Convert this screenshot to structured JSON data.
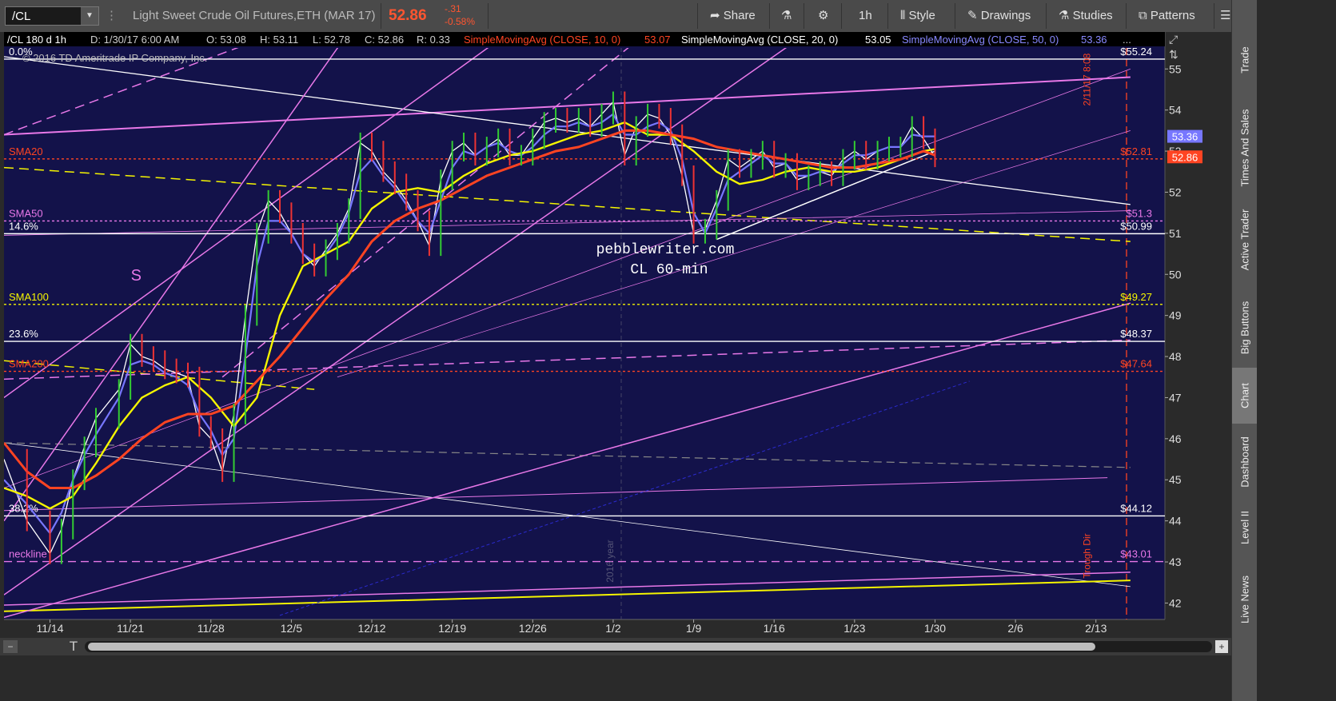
{
  "toolbar": {
    "symbol": "/CL",
    "description": "Light Sweet Crude Oil Futures,ETH (MAR 17)",
    "last": "52.86",
    "change": "-.31",
    "change_pct": "-0.58%",
    "share": "Share",
    "timeframe": "1h",
    "style": "Style",
    "drawings": "Drawings",
    "studies": "Studies",
    "patterns": "Patterns"
  },
  "header": {
    "symbol_period": "/CL 180 d 1h",
    "date": "D: 1/30/17 6:00 AM",
    "open": "O: 53.08",
    "high": "H: 53.11",
    "low": "L: 52.78",
    "close": "C: 52.86",
    "range": "R: 0.33",
    "sma10_label": "SimpleMovingAvg (CLOSE, 10, 0)",
    "sma10_val": "53.07",
    "sma20_label": "SimpleMovingAvg (CLOSE, 20, 0)",
    "sma20_val": "53.05",
    "sma50_label": "SimpleMovingAvg (CLOSE, 50, 0)",
    "sma50_val": "53.36",
    "more": "..."
  },
  "copyright": "© 2016 TD Ameritrade IP Company, Inc.",
  "watermark": {
    "line1": "pebblewriter.com",
    "line2": "CL  60-min"
  },
  "colors": {
    "bg": "#13124a",
    "magenta": "#e878e8",
    "yellow": "#f5f500",
    "red": "#ff4422",
    "blue": "#7777ff",
    "white": "#ffffff"
  },
  "chart_data": {
    "type": "line",
    "title": "",
    "ylim": [
      41.6,
      55.9
    ],
    "y_ticks": [
      42,
      43,
      44,
      45,
      46,
      47,
      48,
      49,
      50,
      51,
      52,
      53,
      54,
      55
    ],
    "x_ticks": [
      "11/14",
      "11/21",
      "11/28",
      "12/5",
      "12/12",
      "12/19",
      "12/26",
      "1/2",
      "1/9",
      "1/16",
      "1/23",
      "1/30",
      "2/6",
      "2/13"
    ],
    "x_index": [
      0,
      7,
      14,
      21,
      28,
      35,
      42,
      49,
      56,
      63,
      70,
      77,
      84,
      91
    ],
    "x_range": [
      -4,
      97
    ],
    "grid": false,
    "price_labels": [
      {
        "text": "53.36",
        "value": 53.36,
        "color": "#7777ff"
      },
      {
        "text": "52.86",
        "value": 52.86,
        "color": "#ff4422"
      }
    ],
    "series": [
      {
        "name": "Price",
        "color": "#ffffff",
        "x": [
          -4,
          -2,
          0,
          1,
          2,
          3,
          4,
          6,
          7,
          8,
          9,
          10,
          11,
          12,
          13,
          14,
          15,
          16,
          17,
          18,
          19,
          20,
          21,
          22,
          23,
          24,
          25,
          26,
          27,
          28,
          29,
          30,
          31,
          32,
          33,
          34,
          35,
          36,
          37,
          38,
          39,
          40,
          41,
          42,
          43,
          44,
          45,
          46,
          47,
          48,
          49,
          50,
          51,
          52,
          53,
          54,
          55,
          56,
          57,
          58,
          59,
          60,
          61,
          62,
          63,
          64,
          65,
          66,
          67,
          68,
          69,
          70,
          71,
          72,
          73,
          74,
          75,
          76,
          77
        ],
        "values": [
          45.5,
          44.0,
          43.2,
          43.8,
          45.0,
          45.8,
          46.5,
          47.2,
          48.3,
          48.0,
          47.9,
          47.7,
          47.6,
          47.5,
          46.3,
          46.0,
          45.2,
          46.6,
          49.0,
          51.0,
          51.8,
          51.5,
          51.0,
          50.5,
          50.2,
          50.6,
          51.0,
          51.6,
          53.2,
          53.0,
          52.5,
          52.2,
          51.8,
          51.3,
          50.7,
          52.3,
          53.0,
          53.2,
          52.9,
          53.1,
          53.3,
          52.9,
          52.9,
          53.3,
          53.7,
          53.8,
          53.7,
          53.8,
          53.6,
          53.9,
          54.2,
          52.9,
          53.6,
          53.9,
          53.8,
          53.4,
          52.4,
          51.0,
          51.1,
          51.8,
          52.8,
          52.6,
          52.8,
          53.0,
          52.6,
          52.7,
          52.3,
          52.4,
          52.5,
          52.4,
          52.8,
          53.0,
          52.8,
          53.0,
          53.1,
          53.1,
          53.6,
          53.3,
          52.86
        ]
      },
      {
        "name": "SMA10",
        "color": "#7777ff",
        "x": [
          -4,
          -2,
          0,
          1,
          2,
          3,
          4,
          6,
          7,
          8,
          9,
          10,
          11,
          12,
          13,
          14,
          15,
          16,
          17,
          18,
          19,
          20,
          21,
          22,
          23,
          24,
          25,
          26,
          27,
          28,
          29,
          30,
          31,
          32,
          33,
          34,
          35,
          36,
          37,
          38,
          39,
          40,
          41,
          42,
          43,
          44,
          45,
          46,
          47,
          48,
          49,
          50,
          51,
          52,
          53,
          54,
          55,
          56,
          57,
          58,
          59,
          60,
          61,
          62,
          63,
          64,
          65,
          66,
          67,
          68,
          69,
          70,
          71,
          72,
          73,
          74,
          75,
          76,
          77
        ],
        "values": [
          45.0,
          44.4,
          43.7,
          44.2,
          45.0,
          45.6,
          46.1,
          47.0,
          47.8,
          47.9,
          47.8,
          47.6,
          47.5,
          47.3,
          46.6,
          46.2,
          45.6,
          46.0,
          48.0,
          50.2,
          51.3,
          51.3,
          51.0,
          50.5,
          50.3,
          50.5,
          50.9,
          51.5,
          52.5,
          52.8,
          52.4,
          52.1,
          51.7,
          51.3,
          51.0,
          51.8,
          52.6,
          53.0,
          52.9,
          53.1,
          53.2,
          53.0,
          52.9,
          53.1,
          53.4,
          53.6,
          53.6,
          53.7,
          53.6,
          53.7,
          53.9,
          53.4,
          53.4,
          53.6,
          53.7,
          53.5,
          52.8,
          51.5,
          51.0,
          51.6,
          52.3,
          52.5,
          52.7,
          52.9,
          52.7,
          52.7,
          52.4,
          52.4,
          52.5,
          52.5,
          52.7,
          52.9,
          52.9,
          53.0,
          53.1,
          53.1,
          53.4,
          53.36,
          53.36
        ]
      },
      {
        "name": "SMA20",
        "color": "#f5f500",
        "x": [
          -4,
          -2,
          0,
          2,
          4,
          6,
          8,
          10,
          12,
          14,
          16,
          18,
          20,
          22,
          24,
          26,
          28,
          30,
          32,
          34,
          36,
          38,
          40,
          42,
          44,
          46,
          48,
          50,
          52,
          54,
          56,
          58,
          60,
          62,
          64,
          66,
          68,
          70,
          72,
          74,
          76,
          77
        ],
        "values": [
          44.8,
          44.6,
          44.3,
          44.6,
          45.4,
          46.3,
          47.0,
          47.3,
          47.5,
          47.0,
          46.3,
          47.0,
          49.0,
          50.2,
          50.5,
          50.8,
          51.6,
          52.0,
          52.1,
          52.0,
          52.4,
          52.7,
          52.9,
          53.0,
          53.2,
          53.4,
          53.5,
          53.7,
          53.4,
          53.4,
          53.0,
          52.5,
          52.2,
          52.3,
          52.5,
          52.6,
          52.5,
          52.5,
          52.6,
          52.8,
          53.0,
          53.05
        ]
      },
      {
        "name": "SMA50",
        "color": "#ff4422",
        "x": [
          -4,
          -2,
          0,
          2,
          4,
          6,
          8,
          10,
          12,
          14,
          16,
          18,
          20,
          22,
          24,
          26,
          28,
          30,
          32,
          34,
          36,
          38,
          40,
          42,
          44,
          46,
          48,
          50,
          52,
          54,
          56,
          58,
          60,
          62,
          64,
          66,
          68,
          70,
          72,
          74,
          76,
          77
        ],
        "values": [
          45.9,
          45.2,
          44.8,
          44.8,
          45.1,
          45.5,
          46.0,
          46.4,
          46.6,
          46.6,
          46.8,
          47.4,
          48.0,
          48.7,
          49.4,
          50.0,
          50.8,
          51.3,
          51.6,
          51.8,
          52.1,
          52.4,
          52.6,
          52.8,
          53.0,
          53.1,
          53.3,
          53.5,
          53.5,
          53.4,
          53.3,
          53.1,
          53.0,
          52.9,
          52.8,
          52.7,
          52.6,
          52.6,
          52.7,
          52.8,
          53.0,
          52.9
        ]
      }
    ],
    "horizontal_lines": [
      {
        "value": 55.24,
        "color": "#ffffff",
        "dash": "",
        "left_label": "0.0%",
        "right_label": "$55.24",
        "right_color": "#ffffff"
      },
      {
        "value": 52.81,
        "color": "#ff4422",
        "dash": "3,3",
        "left_label": "SMA20",
        "right_label": "$52.81",
        "right_color": "#ff4422"
      },
      {
        "value": 51.3,
        "color": "#e878e8",
        "dash": "3,3",
        "left_label": "SMA50",
        "right_label": "$51.3",
        "right_color": "#e878e8"
      },
      {
        "value": 50.99,
        "color": "#ffffff",
        "dash": "",
        "left_label": "14.6%",
        "right_label": "$50.99",
        "right_color": "#ffffff"
      },
      {
        "value": 49.27,
        "color": "#f5f500",
        "dash": "3,3",
        "left_label": "SMA100",
        "right_label": "$49.27",
        "right_color": "#f5f500"
      },
      {
        "value": 48.37,
        "color": "#ffffff",
        "dash": "",
        "left_label": "23.6%",
        "right_label": "$48.37",
        "right_color": "#ffffff"
      },
      {
        "value": 47.64,
        "color": "#ff4422",
        "dash": "3,3",
        "left_label": "SMA200",
        "right_label": "$47.64",
        "right_color": "#ff4422"
      },
      {
        "value": 44.12,
        "color": "#ffffff",
        "dash": "",
        "left_label": "38.2%",
        "right_label": "$44.12",
        "right_color": "#ffffff"
      },
      {
        "value": 43.01,
        "color": "#e878e8",
        "dash": "10,6",
        "left_label": "neckline",
        "right_label": "$43.01",
        "right_color": "#e878e8"
      }
    ],
    "trend_lines": [
      {
        "x1": -4,
        "y1": 53.4,
        "x2": 94,
        "y2": 54.8,
        "color": "#e878e8",
        "width": 2,
        "dash": ""
      },
      {
        "x1": -4,
        "y1": 55.3,
        "x2": 94,
        "y2": 51.7,
        "color": "#ffffff",
        "width": 1.3,
        "dash": ""
      },
      {
        "x1": -4,
        "y1": 45.9,
        "x2": 94,
        "y2": 42.4,
        "color": "#ffffff",
        "width": 0.8,
        "dash": ""
      },
      {
        "x1": -4,
        "y1": 52.6,
        "x2": 94,
        "y2": 50.8,
        "color": "#f5f500",
        "width": 1.5,
        "dash": "12,7"
      },
      {
        "x1": -4,
        "y1": 47.9,
        "x2": 23,
        "y2": 47.2,
        "color": "#f5f500",
        "width": 1.5,
        "dash": "12,7"
      },
      {
        "x1": -4,
        "y1": 41.8,
        "x2": 94,
        "y2": 42.55,
        "color": "#f5f500",
        "width": 2,
        "dash": ""
      },
      {
        "x1": -4,
        "y1": 41.95,
        "x2": 94,
        "y2": 42.75,
        "color": "#e878e8",
        "width": 1.5,
        "dash": ""
      },
      {
        "x1": -4,
        "y1": 47.45,
        "x2": 94,
        "y2": 48.4,
        "color": "#e878e8",
        "width": 1.5,
        "dash": "12,7"
      },
      {
        "x1": -4,
        "y1": 45.9,
        "x2": 94,
        "y2": 45.3,
        "color": "#888888",
        "width": 1.2,
        "dash": "10,6"
      },
      {
        "x1": -4,
        "y1": 44.25,
        "x2": 92,
        "y2": 45.05,
        "color": "#e878e8",
        "width": 1,
        "dash": ""
      },
      {
        "x1": -4,
        "y1": 50.95,
        "x2": 94,
        "y2": 51.55,
        "color": "#e878e8",
        "width": 0.8,
        "dash": ""
      },
      {
        "x1": -4,
        "y1": 53.4,
        "x2": 20,
        "y2": 55.9,
        "color": "#e878e8",
        "width": 1.5,
        "dash": "12,7"
      },
      {
        "x1": -4,
        "y1": 47.0,
        "x2": 40,
        "y2": 55.9,
        "color": "#e878e8",
        "width": 1.5,
        "dash": ""
      },
      {
        "x1": -4,
        "y1": 44.0,
        "x2": 26,
        "y2": 55.9,
        "color": "#e878e8",
        "width": 1.5,
        "dash": ""
      },
      {
        "x1": -4,
        "y1": 42.2,
        "x2": 66,
        "y2": 55.9,
        "color": "#e878e8",
        "width": 1.5,
        "dash": ""
      },
      {
        "x1": -4,
        "y1": 41.65,
        "x2": 94,
        "y2": 49.3,
        "color": "#e878e8",
        "width": 1.5,
        "dash": ""
      },
      {
        "x1": 15,
        "y1": 47.5,
        "x2": 52,
        "y2": 55.9,
        "color": "#e878e8",
        "width": 1.5,
        "dash": "12,7"
      },
      {
        "x1": -4,
        "y1": 44.8,
        "x2": 94,
        "y2": 55.0,
        "color": "#e878e8",
        "width": 0.8,
        "dash": ""
      },
      {
        "x1": 58,
        "y1": 50.85,
        "x2": 77,
        "y2": 53.0,
        "color": "#ffffff",
        "width": 1.5,
        "dash": ""
      },
      {
        "x1": 25,
        "y1": 47.5,
        "x2": 94,
        "y2": 53.5,
        "color": "#e878e8",
        "width": 0.7,
        "dash": ""
      },
      {
        "x1": 20,
        "y1": 41.7,
        "x2": 80,
        "y2": 47.4,
        "color": "#2b2bd0",
        "width": 1,
        "dash": "4,3"
      }
    ],
    "annotations": [
      {
        "text": "S",
        "x": 7.5,
        "y": 49.85,
        "color": "#e878e8",
        "size": 20
      },
      {
        "text": "2016 year",
        "x": 49,
        "y": 42.5,
        "color": "#555577",
        "size": 12,
        "rotate": -90
      },
      {
        "text": "Trough Dir",
        "x": 90.5,
        "y": 42.6,
        "color": "#ff4422",
        "size": 12,
        "rotate": -90
      },
      {
        "text": "2/11/17 8:08",
        "x": 90.5,
        "y": 54.1,
        "color": "#ff4422",
        "size": 12,
        "rotate": -90
      }
    ]
  },
  "sidebar": {
    "tabs": [
      "Trade",
      "Times And Sales",
      "Active Trader",
      "Big Buttons",
      "Chart",
      "Dashboard",
      "Level II",
      "Live News"
    ]
  }
}
